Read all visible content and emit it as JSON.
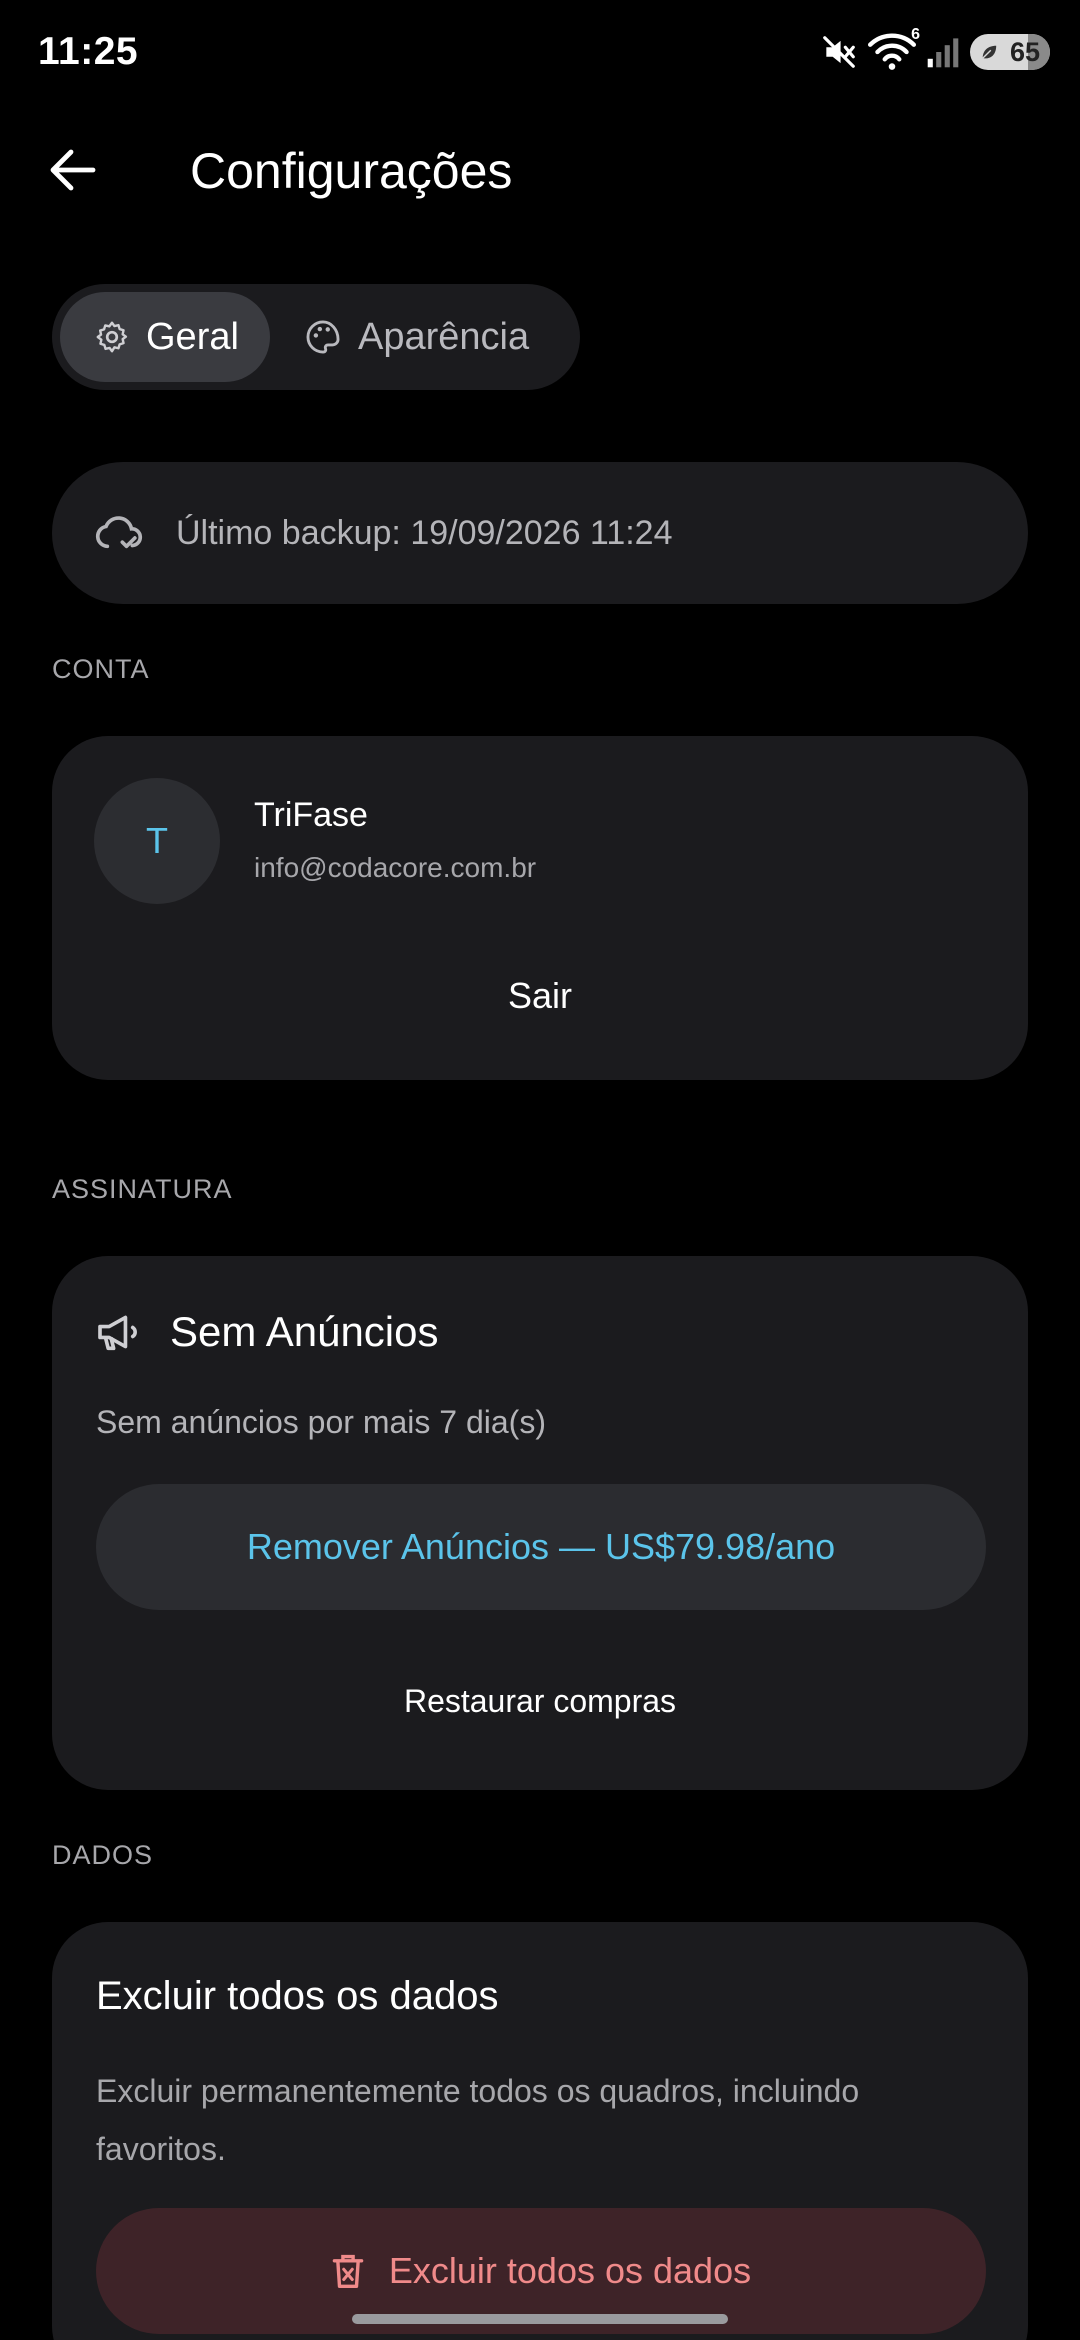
{
  "status_bar": {
    "time": "11:25",
    "battery_level": "65",
    "wifi_badge": "6"
  },
  "header": {
    "title": "Configurações"
  },
  "tabs": [
    {
      "label": "Geral",
      "icon": "gear-icon",
      "active": true
    },
    {
      "label": "Aparência",
      "icon": "palette-icon",
      "active": false
    }
  ],
  "backup": {
    "text": "Último backup: 19/09/2026 11:24",
    "icon": "cloud-check-icon"
  },
  "account": {
    "section_label": "CONTA",
    "avatar_initial": "T",
    "name": "TriFase",
    "email": "info@codacore.com.br",
    "signout_label": "Sair"
  },
  "subscription": {
    "section_label": "ASSINATURA",
    "title": "Sem Anúncios",
    "icon": "megaphone-icon",
    "description": "Sem anúncios por mais 7 dia(s)",
    "remove_ads_label": "Remover Anúncios — US$79.98/ano",
    "restore_label": "Restaurar compras"
  },
  "data": {
    "section_label": "DADOS",
    "title": "Excluir todos os dados",
    "description": "Excluir permanentemente todos os quadros, incluindo favoritos.",
    "delete_label": "Excluir todos os dados",
    "icon": "trash-icon"
  },
  "colors": {
    "background": "#000000",
    "card": "#1b1b1e",
    "accent": "#5bc4ea",
    "danger_text": "#f08a8a",
    "danger_bg": "#3e2328"
  }
}
